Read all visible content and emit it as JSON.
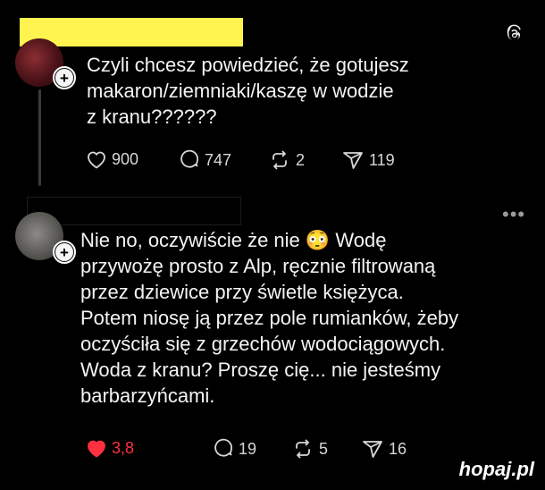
{
  "post1": {
    "text": "Czyli chcesz powiedzieć, że gotujesz\nmakaron/ziemniaki/kaszę w wodzie\nz kranu??????",
    "likes": "900",
    "comments": "747",
    "reposts": "2",
    "shares": "119"
  },
  "post2": {
    "text_before_emoji": "Nie no, oczywiście że nie ",
    "emoji": "😳",
    "text_after_emoji": " Wodę\nprzywożę prosto z Alp, ręcznie filtrowaną\nprzez dziewice przy świetle księżyca.\nPotem niosę ją przez pole rumianków, żeby\noczyściła się z grzechów wodociągowych.\nWoda z kranu? Proszę cię... nie jesteśmy\nbarbarzyńcami.",
    "likes": "3,8",
    "comments": "19",
    "reposts": "5",
    "shares": "16"
  },
  "watermark": "hopaj.pl",
  "colors": {
    "background": "#000000",
    "text": "#f4f4f4",
    "liked_heart": "#ff3040",
    "redaction_yellow": "#fff44f"
  },
  "icons": [
    "threads-logo-icon",
    "heart-icon",
    "comment-icon",
    "repost-icon",
    "share-icon",
    "more-dots-icon",
    "plus-icon"
  ]
}
